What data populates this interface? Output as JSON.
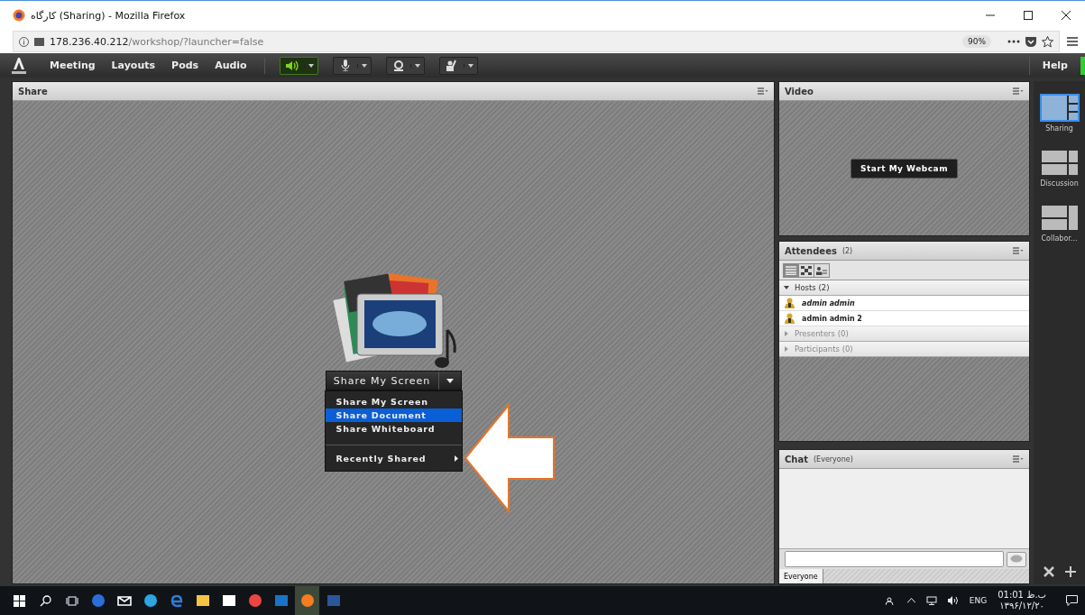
{
  "window": {
    "title": "کارگاه (Sharing) - Mozilla Firefox"
  },
  "address_bar": {
    "host": "178.236.40.212",
    "path": "/workshop/?launcher=false",
    "zoom": "90%"
  },
  "toolbar": {
    "menus": [
      "Meeting",
      "Layouts",
      "Pods",
      "Audio"
    ],
    "help": "Help",
    "devices": [
      {
        "kind": "speaker",
        "on": true
      },
      {
        "kind": "mic",
        "on": false
      },
      {
        "kind": "camera",
        "on": false
      },
      {
        "kind": "hand",
        "on": false
      }
    ]
  },
  "share_pod": {
    "title": "Share",
    "button": "Share My Screen",
    "menu": [
      {
        "kind": "item",
        "label": "Share My Screen",
        "selected": false
      },
      {
        "kind": "item",
        "label": "Share Document",
        "selected": true
      },
      {
        "kind": "item",
        "label": "Share Whiteboard",
        "selected": false
      },
      {
        "kind": "submenu",
        "label": "Recently Shared",
        "selected": false
      }
    ]
  },
  "video_pod": {
    "title": "Video",
    "button": "Start My Webcam"
  },
  "attendees_pod": {
    "title": "Attendees",
    "count": "(2)",
    "views": [
      {
        "kind": "list",
        "selected": true
      },
      {
        "kind": "grid",
        "selected": false
      },
      {
        "kind": "person",
        "selected": false
      }
    ],
    "groups": [
      {
        "label": "Hosts (2)",
        "expanded": true,
        "children": [
          {
            "name": "admin admin",
            "is_me": true
          },
          {
            "name": "admin admin 2",
            "is_me": false
          }
        ]
      },
      {
        "label": "Presenters (0)",
        "expanded": false
      },
      {
        "label": "Participants (0)",
        "expanded": false
      }
    ]
  },
  "chat_pod": {
    "title": "Chat",
    "scope": "(Everyone)",
    "tab": "Everyone"
  },
  "layouts": [
    {
      "label": "Sharing",
      "kind": "sharing",
      "selected": true
    },
    {
      "label": "Discussion",
      "kind": "discussion",
      "selected": false
    },
    {
      "label": "Collabor...",
      "kind": "collab",
      "selected": false
    }
  ],
  "taskbar": {
    "apps": [
      {
        "kind": "ie",
        "selected": false
      },
      {
        "kind": "mail",
        "selected": false
      },
      {
        "kind": "telegram",
        "selected": false
      },
      {
        "kind": "edge",
        "selected": false
      },
      {
        "kind": "folder",
        "selected": false
      },
      {
        "kind": "store",
        "selected": false
      },
      {
        "kind": "chrome",
        "selected": false
      },
      {
        "kind": "outlook",
        "selected": false
      },
      {
        "kind": "firefox",
        "selected": true
      },
      {
        "kind": "word",
        "selected": false
      }
    ],
    "language": "ENG",
    "time": "01:01 ب.ظ",
    "date": "۱۳۹۶/۱۲/۲۰"
  }
}
